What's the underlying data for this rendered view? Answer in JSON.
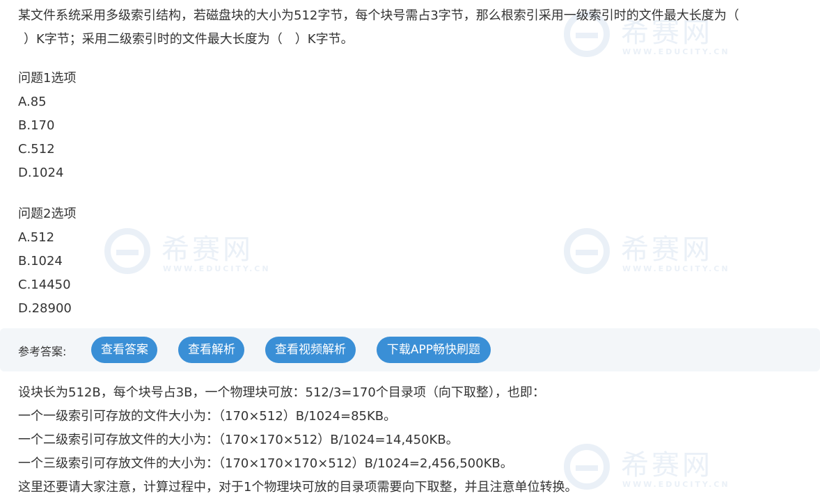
{
  "question": {
    "line1": "某文件系统采用多级索引结构，若磁盘块的大小为512字节，每个块号需占3字节，那么根索引采用一级索引时的文件最大长度为（",
    "line2": "）K字节；采用二级索引时的文件最大长度为（　）K字节。"
  },
  "q1": {
    "title": "问题1选项",
    "options": [
      "A.85",
      "B.170",
      "C.512",
      "D.1024"
    ]
  },
  "q2": {
    "title": "问题2选项",
    "options": [
      "A.512",
      "B.1024",
      "C.14450",
      "D.28900"
    ]
  },
  "answer_bar": {
    "label": "参考答案:",
    "buttons": [
      "查看答案",
      "查看解析",
      "查看视频解析",
      "下载APP畅快刷题"
    ]
  },
  "explanation": [
    "设块长为512B，每个块号占3B，一个物理块可放：512/3=170个目录项（向下取整），也即：",
    "一个一级索引可存放的文件大小为：（170×512）B/1024=85KB。",
    "一个二级索引可存放文件的大小为：（170×170×512）B/1024=14,450KB。",
    "一个三级索引可存放文件的大小为：（170×170×170×512）B/1024=2,456,500KB。",
    "这里还要请大家注意，计算过程中，对于1个物理块可放的目录项需要向下取整，并且注意单位转换。"
  ],
  "watermark": {
    "name": "希赛网",
    "url": "WWW.EDUCITY.CN"
  },
  "colors": {
    "accent": "#3a8fd6",
    "bar_bg": "#f3f6f9",
    "text": "#333333"
  }
}
